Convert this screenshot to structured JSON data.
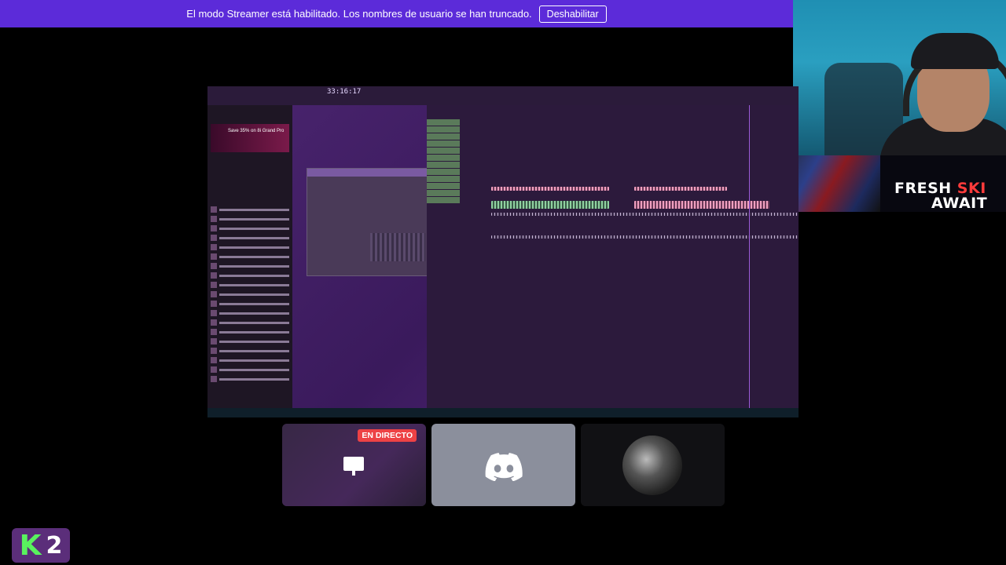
{
  "streamer_banner": {
    "message": "El modo Streamer está habilitado. Los nombres de usuario se han truncado.",
    "disable_label": "Deshabilitar"
  },
  "promo": {
    "line1_prefix": "FRESH ",
    "line1_highlight": "SKI",
    "line2": "AWAIT"
  },
  "shared_screen": {
    "timer": "33:16:17",
    "ad_text": "Save 35% on 8i Grand Pro"
  },
  "tiles": {
    "live_badge": "EN DIRECTO"
  },
  "logo": {
    "letter": "K",
    "number": "2"
  },
  "colors": {
    "banner": "#5c2bd9",
    "live": "#ed4245",
    "discord_tile": "#8b8f9c",
    "logo_green": "#59f25e"
  }
}
